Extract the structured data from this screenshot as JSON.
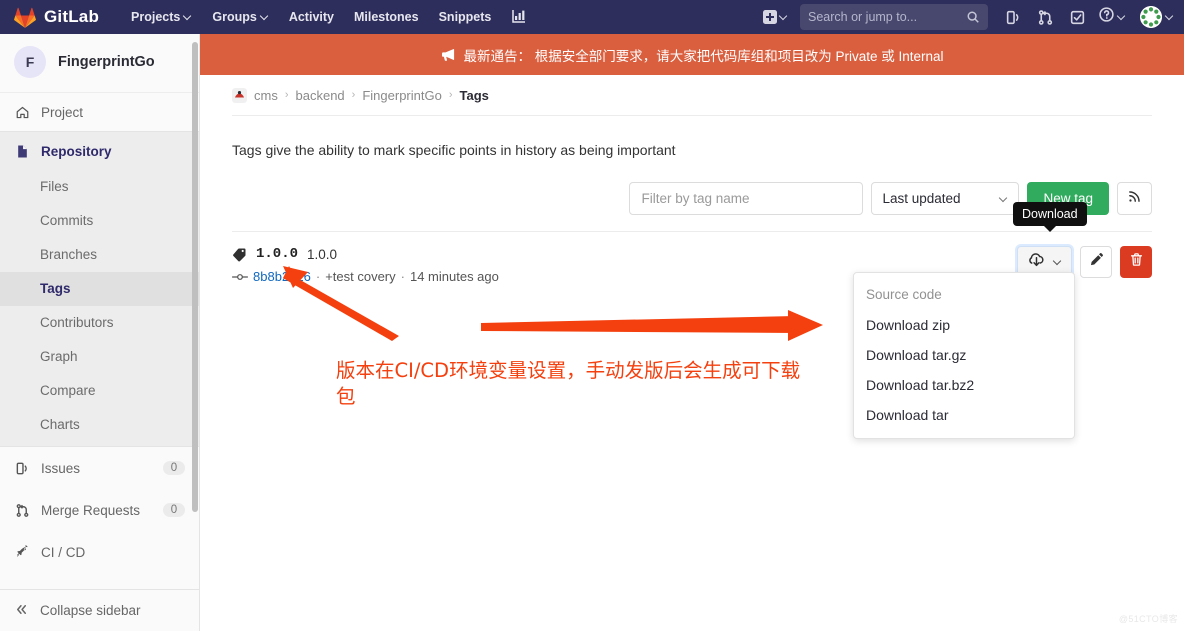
{
  "navbar": {
    "brand": "GitLab",
    "logo_icon": "gitlab-tanuki-logo",
    "links": [
      {
        "label": "Projects",
        "has_caret": true,
        "icon": "chevron-down-icon"
      },
      {
        "label": "Groups",
        "has_caret": true,
        "icon": "chevron-down-icon"
      },
      {
        "label": "Activity",
        "has_caret": false
      },
      {
        "label": "Milestones",
        "has_caret": false
      },
      {
        "label": "Snippets",
        "has_caret": false
      }
    ],
    "analytics_icon": "chart-bar-icon",
    "new_icon": "plus-square-icon",
    "search": {
      "placeholder": "Search or jump to...",
      "value": "",
      "icon": "search-icon"
    },
    "right_icons": [
      {
        "name": "issues-icon",
        "glyph": "issues"
      },
      {
        "name": "merge-requests-icon",
        "glyph": "merge"
      },
      {
        "name": "todos-icon",
        "glyph": "todo"
      },
      {
        "name": "help-icon",
        "glyph": "question"
      }
    ],
    "avatar_icon": "user-avatar-identicon"
  },
  "banner": {
    "icon": "megaphone-icon",
    "text": "最新通告： 根据安全部门要求，请大家把代码库组和项目改为 Private 或 Internal",
    "color": "#d95f3f"
  },
  "sidebar": {
    "project_initial": "F",
    "project_name": "FingerprintGo",
    "items": [
      {
        "label": "Project",
        "icon": "home-icon",
        "active": false
      },
      {
        "label": "Repository",
        "icon": "document-icon",
        "active": true
      }
    ],
    "repository_subitems": [
      {
        "label": "Files",
        "current": false
      },
      {
        "label": "Commits",
        "current": false
      },
      {
        "label": "Branches",
        "current": false
      },
      {
        "label": "Tags",
        "current": true
      },
      {
        "label": "Contributors",
        "current": false
      },
      {
        "label": "Graph",
        "current": false
      },
      {
        "label": "Compare",
        "current": false
      },
      {
        "label": "Charts",
        "current": false
      }
    ],
    "bottom_items": [
      {
        "label": "Issues",
        "icon": "issues-icon",
        "count": "0"
      },
      {
        "label": "Merge Requests",
        "icon": "merge-request-icon",
        "count": "0"
      },
      {
        "label": "CI / CD",
        "icon": "rocket-icon",
        "count": ""
      }
    ],
    "collapse": {
      "label": "Collapse sidebar",
      "icon": "chevron-double-left-icon"
    }
  },
  "breadcrumb": {
    "avatar_icon": "group-avatar-icon",
    "items": [
      "cms",
      "backend",
      "FingerprintGo"
    ],
    "current": "Tags",
    "separator": "›"
  },
  "main": {
    "intro": "Tags give the ability to mark specific points in history as being important",
    "toolbar": {
      "filter_placeholder": "Filter by tag name",
      "filter_value": "",
      "sort_value": "Last updated",
      "sort_caret_icon": "chevron-down-icon",
      "new_tag_label": "New tag",
      "new_tag_color": "#31ab5e",
      "rss_icon": "rss-feed-icon"
    },
    "tag": {
      "tag_icon": "tag-icon",
      "name": "1.0.0",
      "message": "1.0.0",
      "commit_icon": "commit-icon",
      "commit_sha": "8b8b2926",
      "commit_sha_color": "#1068bf",
      "commit_title": "+test covery",
      "separator": "·",
      "time_ago": "14 minutes ago",
      "actions": {
        "download_icon": "download-cloud-icon",
        "download_caret_icon": "chevron-down-icon",
        "edit_icon": "pencil-icon",
        "delete_icon": "trash-icon",
        "delete_color": "#db3b21"
      }
    },
    "tooltip": {
      "text": "Download"
    },
    "dropdown": {
      "header": "Source code",
      "items": [
        {
          "label": "Download zip"
        },
        {
          "label": "Download tar.gz"
        },
        {
          "label": "Download tar.bz2"
        },
        {
          "label": "Download tar"
        }
      ]
    }
  },
  "annotations": {
    "color": "#f4400f",
    "note": "版本在CI/CD环境变量设置，手动发版后会生成可下载包"
  },
  "watermark": "@51CTO博客"
}
